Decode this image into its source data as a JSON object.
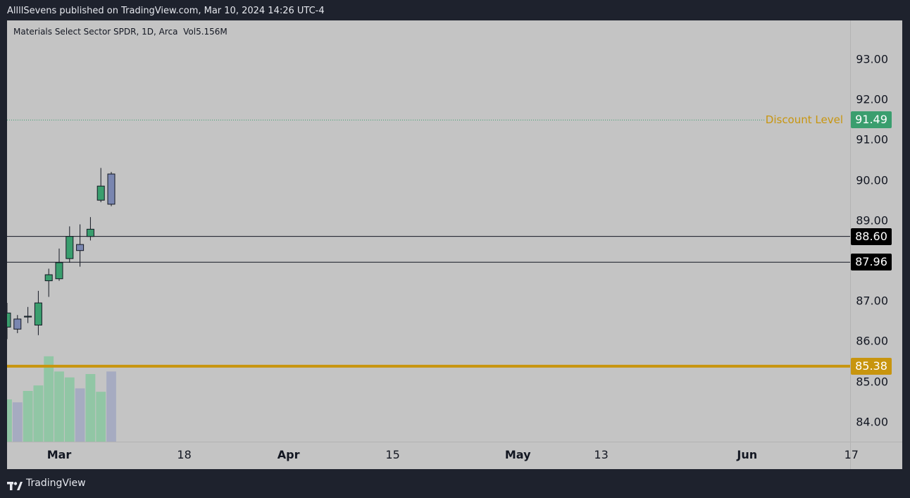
{
  "header": {
    "published": "AllllSevens published on TradingView.com, Mar 10, 2024 14:26 UTC-4"
  },
  "legend": {
    "symbol": "Materials Select Sector SPDR",
    "interval": "1D",
    "exchange": "Arca",
    "volume": "Vol5.156M"
  },
  "footer": {
    "brand": "TradingView",
    "logo_icon": "tradingview-logo-icon"
  },
  "colors": {
    "background": "#1e222d",
    "chart_bg": "#c4c4c4",
    "up_candle": "#3a9e6e",
    "down_candle": "#7a86b0",
    "up_volume": "#8cc6a2",
    "down_volume": "#a3a8c1",
    "support_line": "#c8950e",
    "discount_level": "#c8950e",
    "discount_tag": "#3a9e6e",
    "range_line": "#131722"
  },
  "chart_data": {
    "type": "candlestick",
    "y_axis": {
      "range": [
        83.5,
        94.0
      ],
      "ticks": [
        "93.00",
        "92.00",
        "91.00",
        "90.00",
        "89.00",
        "87.00",
        "86.00",
        "85.00",
        "84.00"
      ],
      "tick_values": [
        93,
        92,
        91,
        90,
        89,
        87,
        86,
        85,
        84
      ]
    },
    "x_axis": {
      "labels": [
        "Mar",
        "18",
        "Apr",
        "15",
        "May",
        "13",
        "Jun",
        "17"
      ],
      "bold_labels": [
        "Mar",
        "Apr",
        "May",
        "Jun"
      ],
      "label_day_index": [
        0,
        12,
        22,
        32,
        44,
        52,
        66,
        76
      ]
    },
    "day_index_of_first_candle": -5,
    "candles": [
      {
        "o": 86.35,
        "h": 86.95,
        "l": 86.05,
        "c": 86.7,
        "v": 1.0
      },
      {
        "o": 86.55,
        "h": 86.65,
        "l": 86.2,
        "c": 86.3,
        "v": 0.93
      },
      {
        "o": 86.6,
        "h": 86.85,
        "l": 86.45,
        "c": 86.62,
        "v": 1.2
      },
      {
        "o": 86.4,
        "h": 87.25,
        "l": 86.15,
        "c": 86.95,
        "v": 1.33
      },
      {
        "o": 87.5,
        "h": 87.8,
        "l": 87.1,
        "c": 87.65,
        "v": 2.02
      },
      {
        "o": 87.55,
        "h": 88.3,
        "l": 87.5,
        "c": 87.95,
        "v": 1.66
      },
      {
        "o": 88.05,
        "h": 88.85,
        "l": 87.95,
        "c": 88.6,
        "v": 1.52
      },
      {
        "o": 88.4,
        "h": 88.9,
        "l": 87.85,
        "c": 88.25,
        "v": 1.26
      },
      {
        "o": 88.6,
        "h": 89.08,
        "l": 88.5,
        "c": 88.78,
        "v": 1.6
      },
      {
        "o": 89.5,
        "h": 90.3,
        "l": 89.45,
        "c": 89.85,
        "v": 1.18
      },
      {
        "o": 90.15,
        "h": 90.2,
        "l": 89.35,
        "c": 89.4,
        "v": 1.66
      }
    ],
    "volume_note": "relative volume heights",
    "horizontal_levels": [
      {
        "price": 91.49,
        "tag": "91.49",
        "label": "Discount Level",
        "style": "dotted"
      },
      {
        "price": 88.6,
        "tag": "88.60",
        "style": "solid"
      },
      {
        "price": 87.96,
        "tag": "87.96",
        "style": "solid"
      },
      {
        "price": 85.38,
        "tag": "85.38",
        "style": "thick"
      }
    ]
  }
}
